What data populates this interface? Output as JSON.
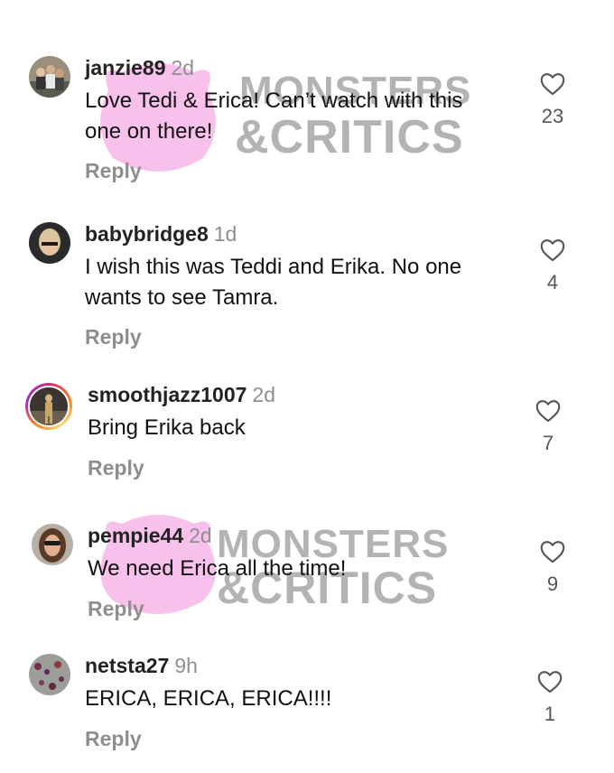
{
  "comments": [
    {
      "user": "janzie89",
      "time": "2d",
      "text": "Love Tedi & Erica! Can’t watch with this one on there!",
      "reply": "Reply",
      "likes": "23"
    },
    {
      "user": "babybridge8",
      "time": "1d",
      "text": "I wish this was Teddi and Erika. No one wants to see Tamra.",
      "reply": "Reply",
      "likes": "4"
    },
    {
      "user": "smoothjazz1007",
      "time": "2d",
      "text": "Bring Erika back",
      "reply": "Reply",
      "likes": "7"
    },
    {
      "user": "pempie44",
      "time": "2d",
      "text": "We need Erica all the time!",
      "reply": "Reply",
      "likes": "9"
    },
    {
      "user": "netsta27",
      "time": "9h",
      "text": "ERICA, ERICA, ERICA!!!!",
      "reply": "Reply",
      "likes": "1"
    }
  ],
  "watermark": {
    "line1": "MONSTERS",
    "line2": "&CRITICS"
  },
  "icons": {
    "like": "heart-outline-icon"
  },
  "colors": {
    "secondary_text": "#8e8e8e",
    "watermark_pink": "#f7b6e8",
    "watermark_gray": "#808080"
  }
}
